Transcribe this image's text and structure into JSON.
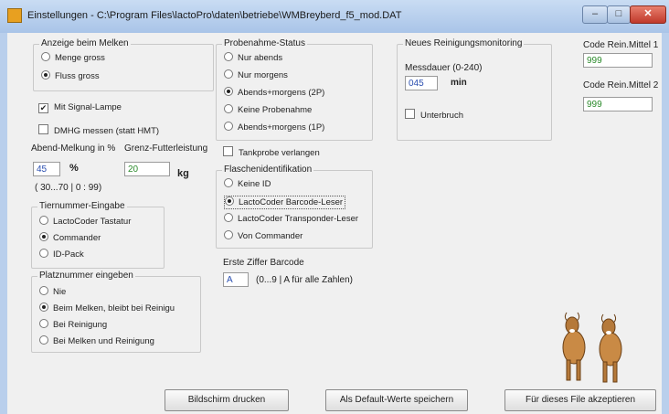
{
  "window": {
    "title": "Einstellungen - C:\\Program Files\\lactoPro\\daten\\betriebe\\WMBreyberd_f5_mod.DAT",
    "min": "–",
    "max": "□",
    "close": "✕"
  },
  "anzeige": {
    "label": "Anzeige beim Melken",
    "options": [
      "Menge gross",
      "Fluss gross"
    ],
    "selected": 1
  },
  "signal_lampe": {
    "label": "Mit Signal-Lampe",
    "checked": true
  },
  "dmhg": {
    "label": "DMHG messen (statt HMT)",
    "checked": false
  },
  "abend": {
    "label": "Abend-Melkung in %",
    "value": "45",
    "unit": "%",
    "range": "( 30...70 | 0 : 99)"
  },
  "grenz": {
    "label": "Grenz-Futterleistung",
    "value": "20",
    "unit": "kg"
  },
  "tiernummer": {
    "label": "Tiernummer-Eingabe",
    "options": [
      "LactoCoder Tastatur",
      "Commander",
      "ID-Pack"
    ],
    "selected": 1
  },
  "platznummer": {
    "label": "Platznummer eingeben",
    "options": [
      "Nie",
      "Beim Melken, bleibt bei Reinigu",
      "Bei Reinigung",
      "Bei Melken und Reinigung"
    ],
    "selected": 1
  },
  "probenahme": {
    "label": "Probenahme-Status",
    "options": [
      "Nur abends",
      "Nur morgens",
      "Abends+morgens (2P)",
      "Keine Probenahme",
      "Abends+morgens (1P)"
    ],
    "selected": 2
  },
  "tankprobe": {
    "label": "Tankprobe verlangen",
    "checked": false
  },
  "flaschen": {
    "label": "Flaschenidentifikation",
    "options": [
      "Keine ID",
      "LactoCoder Barcode-Leser",
      "LactoCoder Transponder-Leser",
      "Von Commander"
    ],
    "selected": 1
  },
  "erste_ziffer": {
    "label": "Erste Ziffer Barcode",
    "value": "A",
    "hint": "(0...9 | A für alle Zahlen)"
  },
  "reinigung": {
    "label": "Neues Reinigungsmonitoring",
    "messdauer_label": "Messdauer (0-240)",
    "messdauer_value": "045",
    "unit": "min",
    "unterbruch_label": "Unterbruch",
    "unterbruch_checked": false
  },
  "code1": {
    "label": "Code Rein.Mittel 1",
    "value": "999"
  },
  "code2": {
    "label": "Code Rein.Mittel 2",
    "value": "999"
  },
  "buttons": {
    "print": "Bildschirm drucken",
    "default": "Als Default-Werte speichern",
    "accept": "Für dieses File akzeptieren"
  }
}
